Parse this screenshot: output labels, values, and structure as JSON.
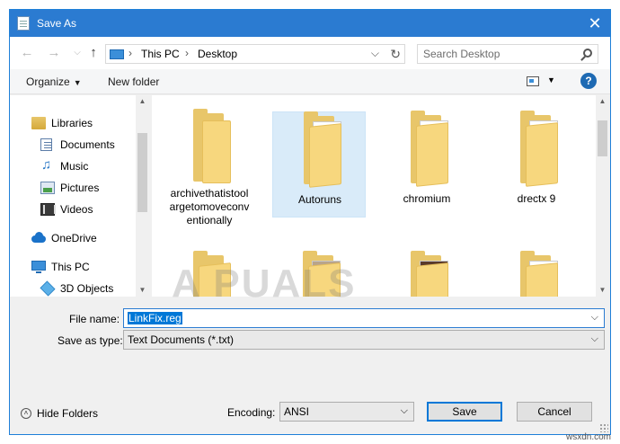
{
  "window": {
    "title": "Save As",
    "close_symbol": "✕",
    "accent_color": "#2b7bd1"
  },
  "navigation": {
    "back_symbol": "←",
    "forward_symbol": "→",
    "up_symbol": "↑",
    "breadcrumb": [
      "This PC",
      "Desktop"
    ],
    "separator": "›",
    "dropdown_symbol": "⌵",
    "refresh_symbol": "↻",
    "search_placeholder": "Search Desktop"
  },
  "toolbar": {
    "organize_label": "Organize",
    "organize_caret": "▼",
    "new_folder_label": "New folder",
    "view_caret": "▼",
    "help_label": "?"
  },
  "nav_pane": {
    "items": [
      {
        "label": "Libraries",
        "icon": "library-icon"
      },
      {
        "label": "Documents",
        "icon": "documents-icon"
      },
      {
        "label": "Music",
        "icon": "music-icon"
      },
      {
        "label": "Pictures",
        "icon": "pictures-icon"
      },
      {
        "label": "Videos",
        "icon": "videos-icon"
      },
      {
        "label": "OneDrive",
        "icon": "onedrive-icon"
      },
      {
        "label": "This PC",
        "icon": "this-pc-icon"
      },
      {
        "label": "3D Objects",
        "icon": "3d-objects-icon"
      }
    ],
    "scroll_up_symbol": "▲",
    "scroll_down_symbol": "▼"
  },
  "files": {
    "items": [
      {
        "label": "archivethatistoolargetomoveconventionally",
        "label_lines": [
          "archivethatistool",
          "argetomoveconv",
          "entionally"
        ],
        "selected": false
      },
      {
        "label": "Autoruns",
        "label_lines": [
          "Autoruns"
        ],
        "selected": true
      },
      {
        "label": "chromium",
        "label_lines": [
          "chromium"
        ],
        "selected": false
      },
      {
        "label": "drectx 9",
        "label_lines": [
          "drectx 9"
        ],
        "selected": false
      }
    ]
  },
  "form": {
    "file_name_label": "File name:",
    "file_name_value": "LinkFix.reg",
    "save_type_label": "Save as type:",
    "save_type_value": "Text Documents (*.txt)",
    "dropdown_symbol": "⌵"
  },
  "footer": {
    "hide_folders_label": "Hide Folders",
    "hide_folders_symbol": "˄",
    "encoding_label": "Encoding:",
    "encoding_value": "ANSI",
    "save_label": "Save",
    "cancel_label": "Cancel"
  },
  "watermark": "A  PUALS",
  "site_credit": "wsxdn.com"
}
